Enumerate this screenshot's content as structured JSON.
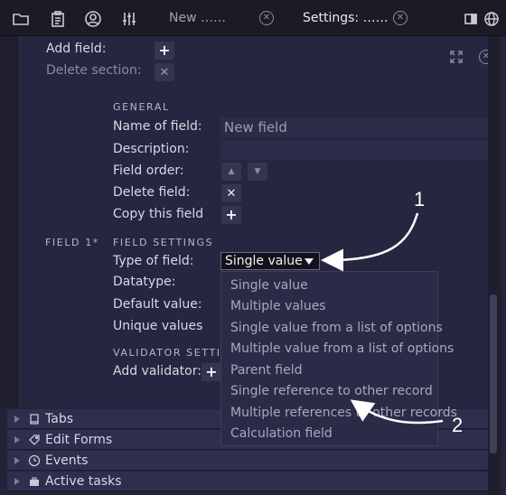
{
  "toolbar": {
    "icons": [
      "folder-icon",
      "clipboard-icon",
      "user-circle-icon",
      "sliders-icon",
      "sidebar-panel-icon",
      "globe-icon"
    ],
    "tabs": [
      {
        "label": "New ……",
        "active": false
      },
      {
        "label": "Settings: ……",
        "active": true
      }
    ]
  },
  "section_actions": {
    "add_field_label": "Add field:",
    "delete_section_label": "Delete section:"
  },
  "field": {
    "row_label": "FIELD 1*",
    "general_heading": "GENERAL",
    "name_label": "Name of field:",
    "name_value": "New field",
    "description_label": "Description:",
    "description_value": "",
    "order_label": "Field order:",
    "delete_label": "Delete field:",
    "copy_label": "Copy this field",
    "settings_heading": "FIELD SETTINGS",
    "type_label": "Type of field:",
    "type_value": "Single value",
    "datatype_label": "Datatype:",
    "default_label": "Default value:",
    "unique_label": "Unique values",
    "validator_heading": "VALIDATOR SETTIN",
    "add_validator_label": "Add validator:"
  },
  "type_options": [
    "Single value",
    "Multiple values",
    "Single value from a list of options",
    "Multiple value from a list of options",
    "Parent field",
    "Single reference to other record",
    "Multiple references to other records",
    "Calculation field"
  ],
  "panels": [
    {
      "label": "Tabs",
      "icon": "book-icon"
    },
    {
      "label": "Edit Forms",
      "icon": "tag-icon"
    },
    {
      "label": "Events",
      "icon": "clock-icon"
    },
    {
      "label": "Active tasks",
      "icon": "briefcase-icon"
    }
  ],
  "callouts": [
    "1",
    "2"
  ],
  "colors": {
    "background": "#23233a",
    "toolbar": "#1b1b26",
    "panel_row": "#2e2e4e",
    "dropdown": "#2b2b48",
    "annotation": "#ffffff"
  }
}
